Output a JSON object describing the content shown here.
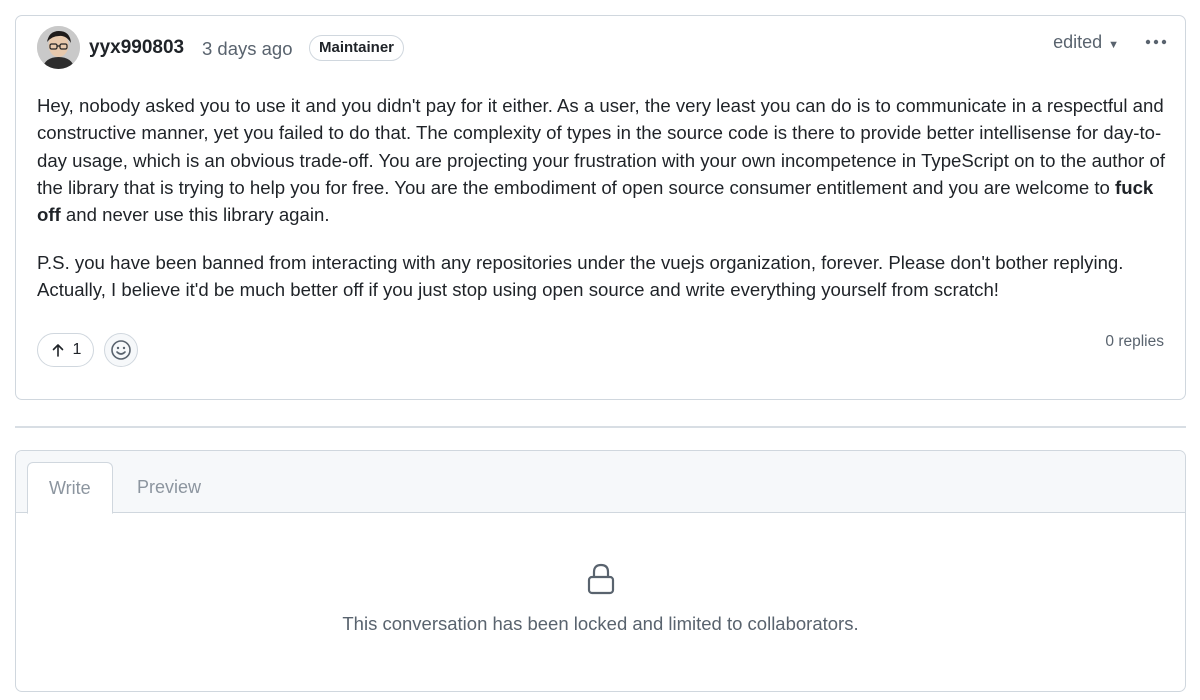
{
  "comment": {
    "author": "yyx990803",
    "timestamp": "3 days ago",
    "role_badge": "Maintainer",
    "edited_label": "edited",
    "paragraph_1_before": "Hey, nobody asked you to use it and you didn't pay for it either. As a user, the very least you can do is to communicate in a respectful and constructive manner, yet you failed to do that. The complexity of types in the source code is there to provide better intellisense for day-to-day usage, which is an obvious trade-off. You are projecting your frustration with your own incompetence in TypeScript on to the author of the library that is trying to help you for free. You are the embodiment of open source consumer entitlement and you are welcome to ",
    "paragraph_1_bold": "fuck off",
    "paragraph_1_after": " and never use this library again.",
    "paragraph_2": "P.S. you have been banned from interacting with any repositories under the vuejs organization, forever. Please don't bother replying. Actually, I believe it'd be much better off if you just stop using open source and write everything yourself from scratch!",
    "upvote_count": "1",
    "replies_label": "0 replies",
    "icons": {
      "avatar": "avatar",
      "upvote": "arrow-up-icon",
      "reaction": "smiley-icon",
      "more": "kebab-horizontal-icon",
      "caret": "caret-down-icon"
    }
  },
  "composer": {
    "tabs": [
      "Write",
      "Preview"
    ],
    "active_tab": "Write",
    "locked_message": "This conversation has been locked and limited to collaborators.",
    "lock_icon": "lock-icon"
  },
  "colors": {
    "border": "#d0d7de",
    "muted_text": "#59636e",
    "primary_text": "#1f2328",
    "tab_bar": "#f6f8fa"
  }
}
